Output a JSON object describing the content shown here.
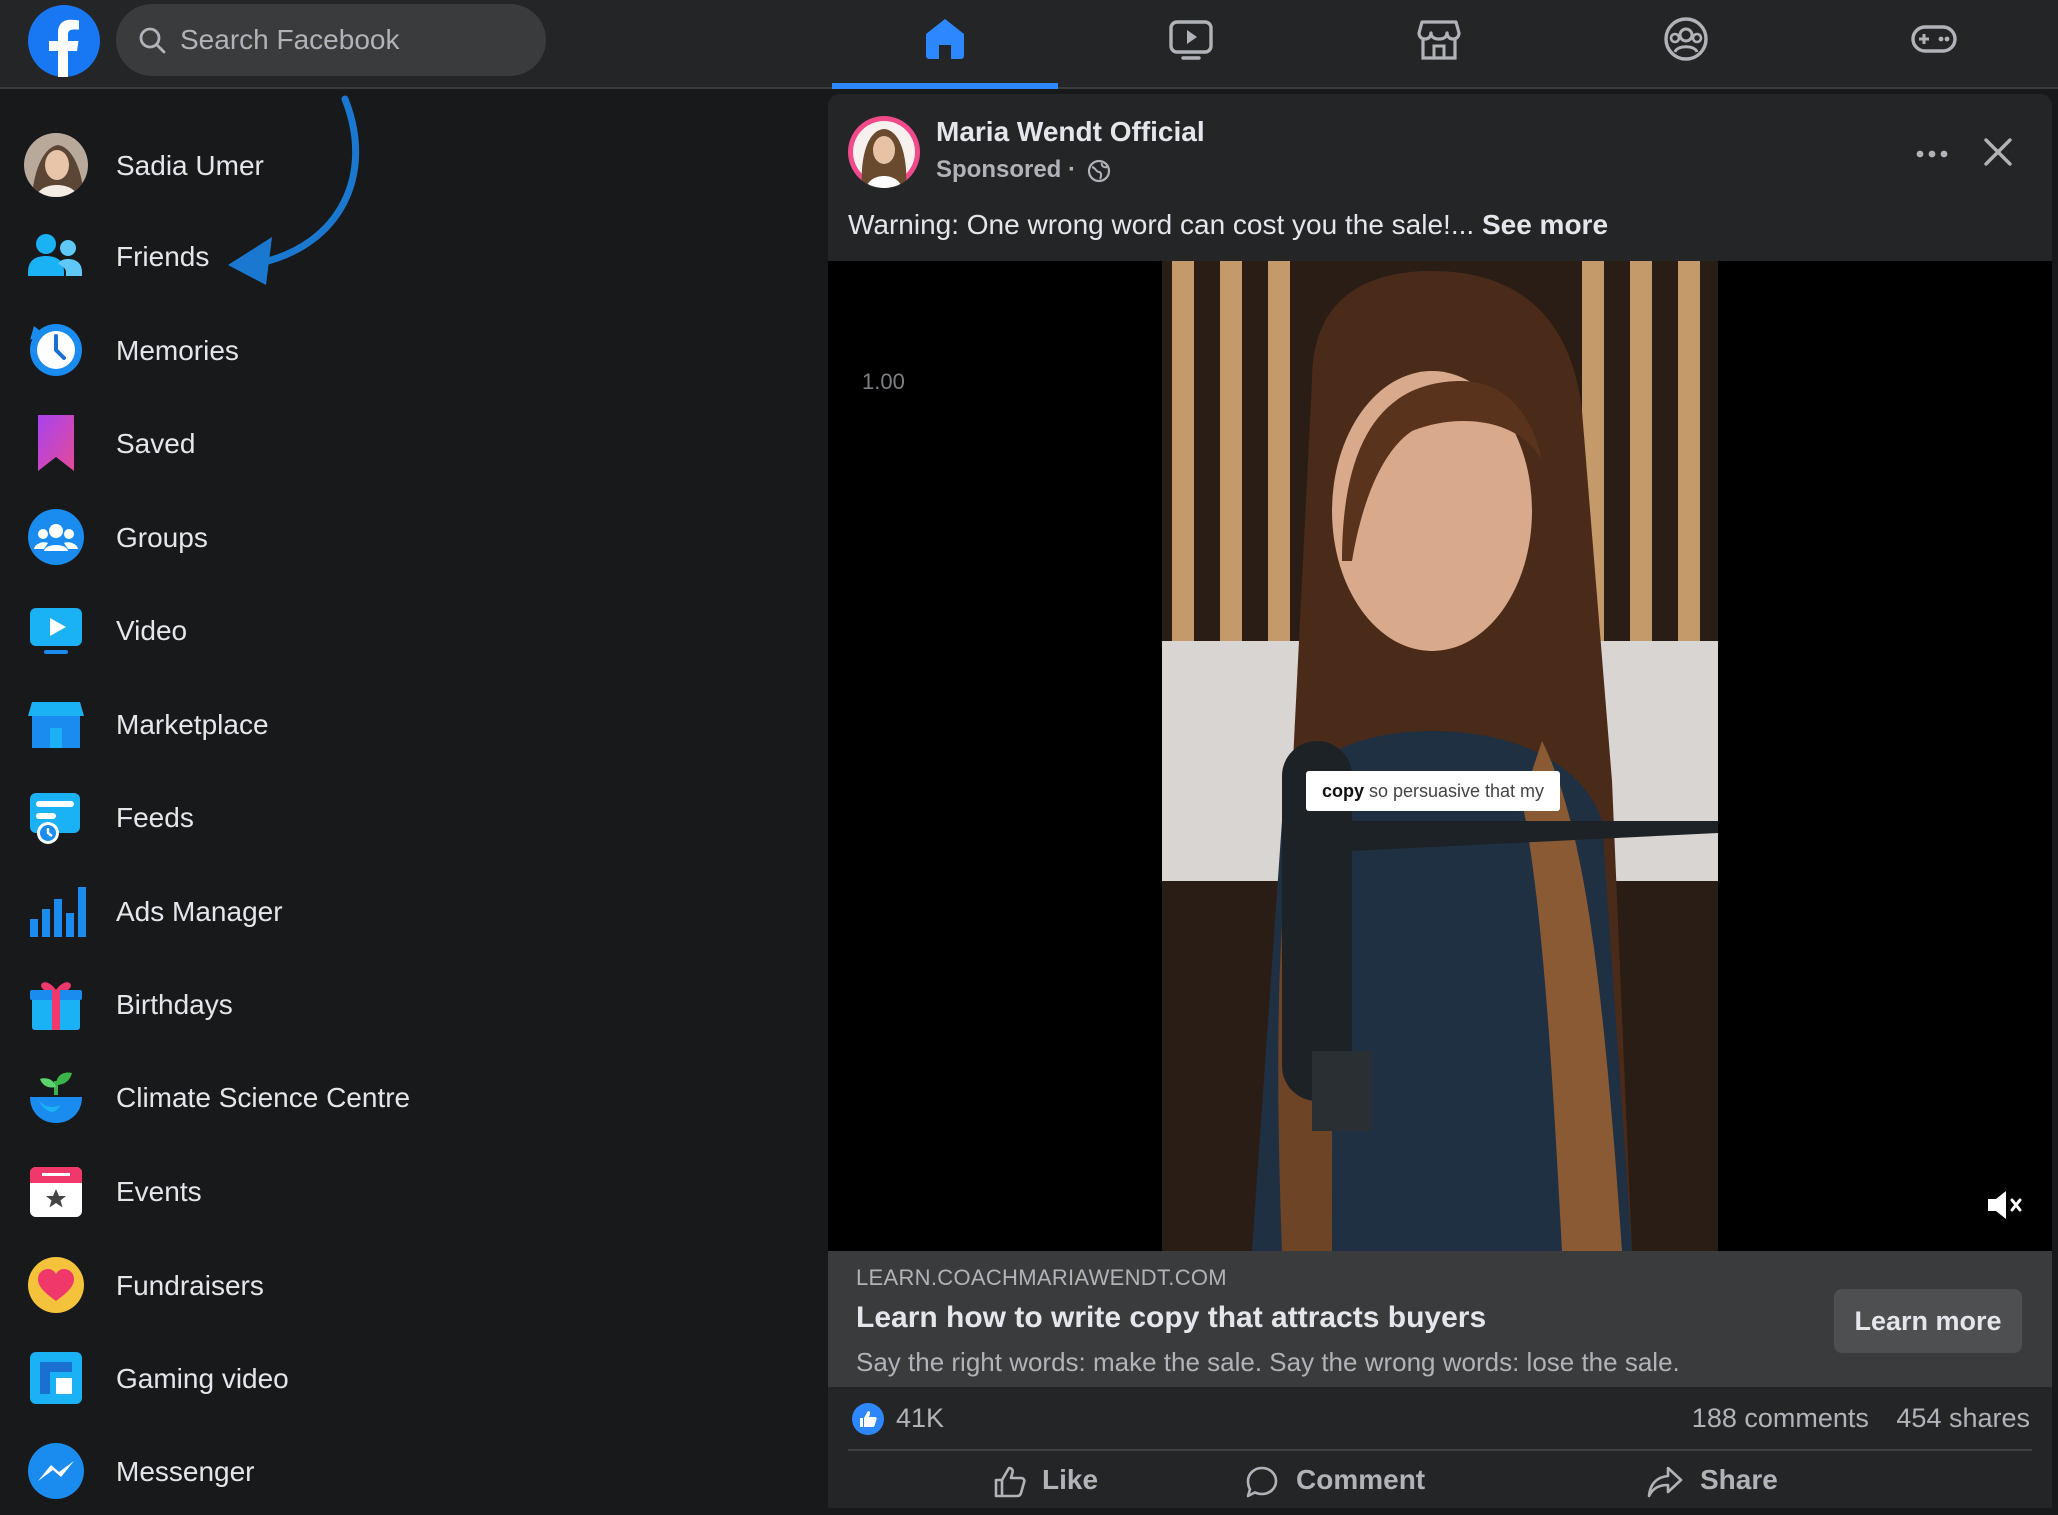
{
  "topbar": {
    "search_placeholder": "Search Facebook",
    "nav": [
      "home-icon",
      "watch-icon",
      "marketplace-icon",
      "groups-icon",
      "gaming-icon"
    ],
    "active_nav": "home-icon",
    "accent": "#2d88ff"
  },
  "sidebar": {
    "user": "Sadia Umer",
    "items": [
      {
        "label": "Friends",
        "icon": "friends-icon"
      },
      {
        "label": "Memories",
        "icon": "memories-icon"
      },
      {
        "label": "Saved",
        "icon": "saved-icon"
      },
      {
        "label": "Groups",
        "icon": "groups-icon"
      },
      {
        "label": "Video",
        "icon": "video-icon"
      },
      {
        "label": "Marketplace",
        "icon": "marketplace-icon"
      },
      {
        "label": "Feeds",
        "icon": "feeds-icon"
      },
      {
        "label": "Ads Manager",
        "icon": "ads-manager-icon"
      },
      {
        "label": "Birthdays",
        "icon": "birthdays-icon"
      },
      {
        "label": "Climate Science Centre",
        "icon": "climate-icon"
      },
      {
        "label": "Events",
        "icon": "events-icon"
      },
      {
        "label": "Fundraisers",
        "icon": "fundraisers-icon"
      },
      {
        "label": "Gaming video",
        "icon": "gaming-video-icon"
      },
      {
        "label": "Messenger",
        "icon": "messenger-icon"
      }
    ]
  },
  "post": {
    "author": "Maria Wendt Official",
    "meta": "Sponsored ·",
    "text": "Warning: One wrong word can cost you the sale!...",
    "see_more": "See more",
    "video": {
      "speed": "1.00",
      "caption_strong": "copy",
      "caption_rest": "so persuasive that my"
    },
    "link": {
      "domain": "LEARN.COACHMARIAWENDT.COM",
      "title": "Learn how to write copy that attracts buyers",
      "description": "Say the right words: make the sale. Say the wrong words: lose the sale.",
      "button": "Learn more"
    },
    "stats": {
      "likes": "41K",
      "comments": "188 comments",
      "shares": "454 shares"
    },
    "actions": {
      "like": "Like",
      "comment": "Comment",
      "share": "Share"
    }
  }
}
